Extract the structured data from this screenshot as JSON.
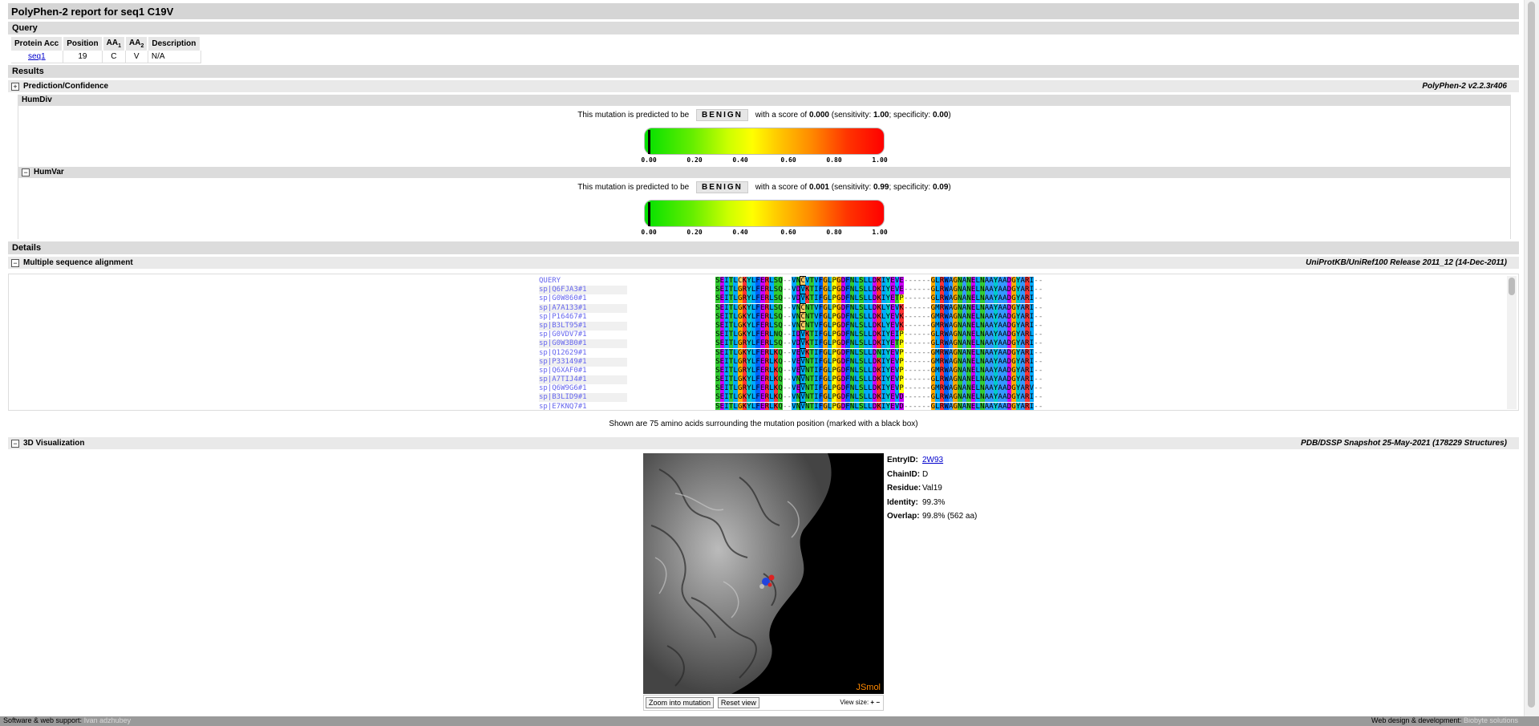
{
  "report_title": "PolyPhen-2 report for seq1 C19V",
  "query": {
    "heading": "Query",
    "headers": [
      "Protein Acc",
      "Position",
      "AA1",
      "AA2",
      "Description"
    ],
    "row": {
      "acc": "seq1",
      "position": "19",
      "aa1": "C",
      "aa2": "V",
      "description": "N/A"
    }
  },
  "results": {
    "heading": "Results",
    "prediction_label": "Prediction/Confidence",
    "version": "PolyPhen-2 v2.2.3r406",
    "humdiv": {
      "label": "HumDiv",
      "prefix": "This mutation is predicted to be",
      "verdict": "BENIGN",
      "score_text": "with a score of",
      "score": "0.000",
      "sens_label": "(sensitivity:",
      "sensitivity": "1.00",
      "spec_label": "; specificity:",
      "specificity": "0.00",
      "close": ")",
      "score_value": 0.0
    },
    "humvar": {
      "label": "HumVar",
      "prefix": "This mutation is predicted to be",
      "verdict": "BENIGN",
      "score_text": "with a score of",
      "score": "0.001",
      "sens_label": "(sensitivity:",
      "sensitivity": "0.99",
      "spec_label": "; specificity:",
      "specificity": "0.09",
      "close": ")",
      "score_value": 0.001
    },
    "gauge_ticks": [
      "0.00",
      "0.20",
      "0.40",
      "0.60",
      "0.80",
      "1.00"
    ]
  },
  "details": {
    "heading": "Details",
    "msa_label": "Multiple sequence alignment",
    "msa_source": "UniProtKB/UniRef100 Release 2011_12 (14-Dec-2011)",
    "msa_caption": "Shown are 75 amino acids surrounding the mutation position (marked with a black box)",
    "alignment": [
      {
        "name": "QUERY",
        "seq": "SEITLCKYLFERLSQ--VNCVTVFGLPGDFNLSLLDKIYEVE------GLRWAGNANELNAAYAADGYARI--"
      },
      {
        "name": "sp|Q6FJA3#1",
        "seq": "SEITLGRYLFERLSQ--VDVKTIFGLPGDFNLSLLDKIYEVE------GLRWAGNANELNAAYAADGYARI--"
      },
      {
        "name": "sp|G0W860#1",
        "seq": "SEITLGRYLFERLSQ--VDVKTIFGLPGDFNLSLLDKIYETP------GLRWAGNANELNAAYAADGYARI--"
      },
      {
        "name": "sp|A7A133#1",
        "seq": "SEITLGKYLFERLSQ--VNCNTVFGLPGDFNLSLLDKLYEVK------GMRWAGNANELNAAYAADGYARI--"
      },
      {
        "name": "sp|P16467#1",
        "seq": "SEITLGKYLFERLSQ--VNCNTVFGLPGDFNLSLLDKLYEVK------GMRWAGNANELNAAYAADGYARI--"
      },
      {
        "name": "sp|B3LT95#1",
        "seq": "SEITLGKYLFERLSQ--VNCNTVFGLPGDFNLSLLDKLYEVK------GMRWAGNANELNAAYAADGYARI--"
      },
      {
        "name": "sp|G0VDV7#1",
        "seq": "SEITLGKYLFERLNQ--IDVKTIFGLPGDFNLSLLDKIYEIP------GLRWAGNANELNAAYAADGYARL--"
      },
      {
        "name": "sp|G0W3B0#1",
        "seq": "SEITLGRYLFERLSQ--VDVKTIFGLPGDFNLSLLDKIYETP------GLRWAGNANELNAAYAADGYARI--"
      },
      {
        "name": "sp|Q12629#1",
        "seq": "SEITLGKYLFERLKQ--VEVKTIFGLPGDFNLSLLDNIYEVP------GMRWAGNANELNAAYAADGYARI--"
      },
      {
        "name": "sp|P33149#1",
        "seq": "SEITLGRYLFERLKQ--VEVNTIFGLPGDFNLSLLDKIYEVP------GMRWAGNANELNAAYAADGYARI--"
      },
      {
        "name": "sp|Q6XAF0#1",
        "seq": "SEITLGRYLFERLKQ--VEVNTIFGLPGDFNLSLLDKIYEVP------GMRWAGNANELNAAYAADGYARI--"
      },
      {
        "name": "sp|A7TIJ4#1",
        "seq": "SEITLGKYLFERLKQ--VNVNTIFGLPGDFNLSLLDKIYEVP------GLRWAGNANELNAAYAADGYARI--"
      },
      {
        "name": "sp|Q6W9G6#1",
        "seq": "SEITLGRYLFERLKQ--VEVNTIFGLPGDFNLSLLDKIYEVP------GMRWAGNANELNAAYAADGYARV--"
      },
      {
        "name": "sp|B3LID9#1",
        "seq": "SEITLGKYLFERLKQ--VNVNTIFGLPGDFNLSLLDKIYEVD------GLRWAGNANELNAAYAADGYARI--"
      },
      {
        "name": "sp|E7KNQ7#1",
        "seq": "SEITLGKYLFERLKQ--VNVNTIFGLPGDFNLSLLDKIYEVD------GLRWAGNANELNAAYAADGYARI--"
      }
    ],
    "viz_label": "3D Visualization",
    "viz_source": "PDB/DSSP Snapshot 25-May-2021 (178229 Structures)",
    "jsmol": "JSmol",
    "zoom_btn": "Zoom into mutation",
    "reset_btn": "Reset view",
    "view_size": "View size:",
    "info": {
      "entry_label": "EntryID:",
      "entry": "2W93",
      "chain_label": "ChainID:",
      "chain": "D",
      "residue_label": "Residue:",
      "residue": "Val19",
      "identity_label": "Identity:",
      "identity": "99.3%",
      "overlap_label": "Overlap:",
      "overlap": "99.8% (562 aa)"
    }
  },
  "footer": {
    "left_label": "Software & web support:",
    "left_name": "Ivan adzhubey",
    "right_label": "Web design & development:",
    "right_name": "Biobyte solutions"
  },
  "aa_colors": {
    "S": "#33cc33",
    "T": "#33cc33",
    "N": "#33cc33",
    "Q": "#33cc33",
    "E": "#cc00ff",
    "D": "#cc00ff",
    "K": "#ff3333",
    "R": "#ff3333",
    "H": "#ff9999",
    "I": "#00aaff",
    "L": "#00aaff",
    "V": "#00aaff",
    "M": "#00aaff",
    "A": "#3399ff",
    "F": "#0066ff",
    "W": "#0066ff",
    "Y": "#00cccc",
    "G": "#ffaa00",
    "P": "#ffff00",
    "C": "#ffcc66",
    "-": "#ffffff"
  }
}
